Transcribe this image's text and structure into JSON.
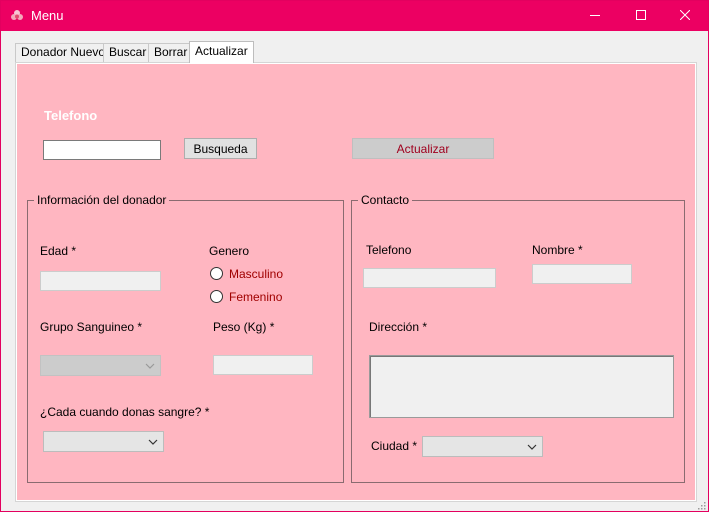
{
  "window": {
    "title": "Menu",
    "accent_color": "#ec0062",
    "panel_color": "#ffb6c1"
  },
  "tabs": [
    {
      "label": "Donador Nuevo",
      "active": false
    },
    {
      "label": "Buscar",
      "active": false
    },
    {
      "label": "Borrar",
      "active": false
    },
    {
      "label": "Actualizar",
      "active": true
    }
  ],
  "search": {
    "heading": "Telefono",
    "input_value": "",
    "search_button": "Busqueda",
    "update_button": "Actualizar"
  },
  "donor_group": {
    "title": "Información del donador",
    "age_label": "Edad *",
    "age_value": "",
    "gender_label": "Genero",
    "gender_options": [
      "Masculino",
      "Femenino"
    ],
    "blood_type_label": "Grupo Sanguineo *",
    "blood_type_value": "",
    "weight_label": "Peso (Kg) *",
    "weight_value": "",
    "frequency_label": "¿Cada cuando donas sangre? *",
    "frequency_value": ""
  },
  "contact_group": {
    "title": "Contacto",
    "phone_label": "Telefono",
    "phone_value": "",
    "name_label": "Nombre *",
    "name_value": "",
    "address_label": "Dirección *",
    "address_value": "",
    "city_label": "Ciudad *",
    "city_value": ""
  },
  "icons": {
    "app": "flower-app-icon",
    "minimize": "minimize-icon",
    "maximize": "maximize-icon",
    "close": "close-icon",
    "dropdown": "chevron-down-icon",
    "resize": "resize-grip-icon"
  }
}
